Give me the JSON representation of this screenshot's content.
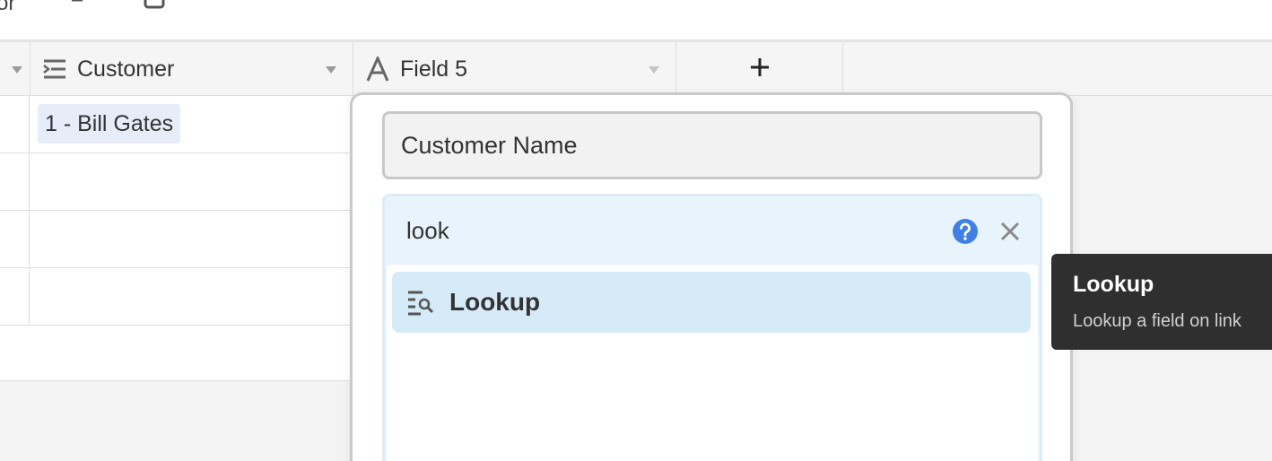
{
  "toolbar": {
    "partial_label": "or",
    "icons": [
      "sort-icon",
      "share-view-icon",
      "more-icon"
    ]
  },
  "grid": {
    "columns": [
      {
        "label": "",
        "icon": "caret-icon"
      },
      {
        "label": "Customer",
        "icon": "link-field-icon"
      },
      {
        "label": "Field 5",
        "icon": "text-field-icon"
      },
      {
        "label": "+",
        "icon": "add-field-icon"
      }
    ],
    "rows": [
      {
        "customer": "1 - Bill Gates"
      },
      {
        "customer": ""
      },
      {
        "customer": ""
      },
      {
        "customer": ""
      }
    ]
  },
  "field_config": {
    "name_value": "Customer Name",
    "type_search_value": "look",
    "results": [
      {
        "label": "Lookup",
        "icon": "lookup-icon"
      }
    ]
  },
  "tooltip": {
    "title": "Lookup",
    "description": "Lookup a field on link"
  },
  "colors": {
    "help_blue": "#3f7fe8",
    "chip_bg": "#e6ecf8",
    "panel_bg": "#e8f4fc",
    "result_bg": "#d5ebf8",
    "tooltip_bg": "#2f2f2f"
  }
}
